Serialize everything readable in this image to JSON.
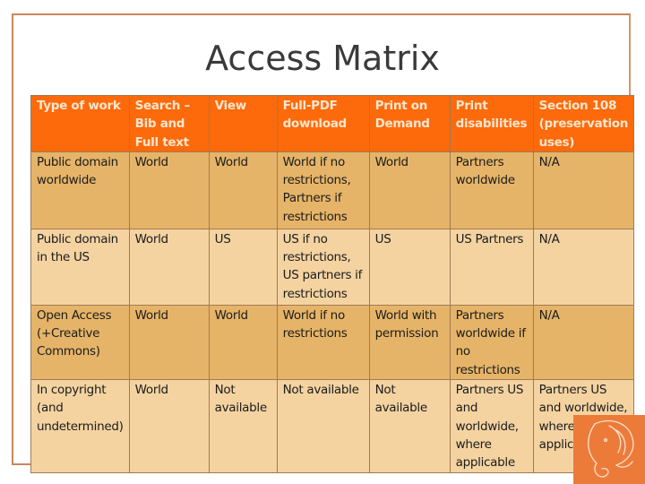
{
  "slide": {
    "title": "Access Matrix",
    "colors": {
      "frame": "#c8875a",
      "header_bg": "#fd6a0b",
      "header_text": "#fbe6cf",
      "row_odd_bg": "#e6b468",
      "row_even_bg": "#f4d3a1",
      "logo_bg": "#ec7b3a"
    },
    "logo_icon": "elephant-icon"
  },
  "table": {
    "headers": [
      "Type of work",
      "Search – Bib and Full text",
      "View",
      "Full-PDF download",
      "Print on Demand",
      "Print disabilities",
      "Section 108 (preservation uses)"
    ],
    "rows": [
      [
        "Public domain worldwide",
        "World",
        "World",
        "World if no restrictions, Partners if restrictions",
        "World",
        "Partners worldwide",
        "N/A"
      ],
      [
        "Public domain in the US",
        "World",
        "US",
        "US if no restrictions, US partners if restrictions",
        "US",
        "US Partners",
        "N/A"
      ],
      [
        "Open Access (+Creative Commons)",
        "World",
        "World",
        "World if no restrictions",
        "World with permission",
        "Partners worldwide if no restrictions",
        "N/A"
      ],
      [
        "In copyright (and undetermined)",
        "World",
        "Not available",
        "Not available",
        "Not available",
        "Partners US and worldwide, where applicable",
        "Partners US and worldwide, where applicable"
      ]
    ]
  }
}
